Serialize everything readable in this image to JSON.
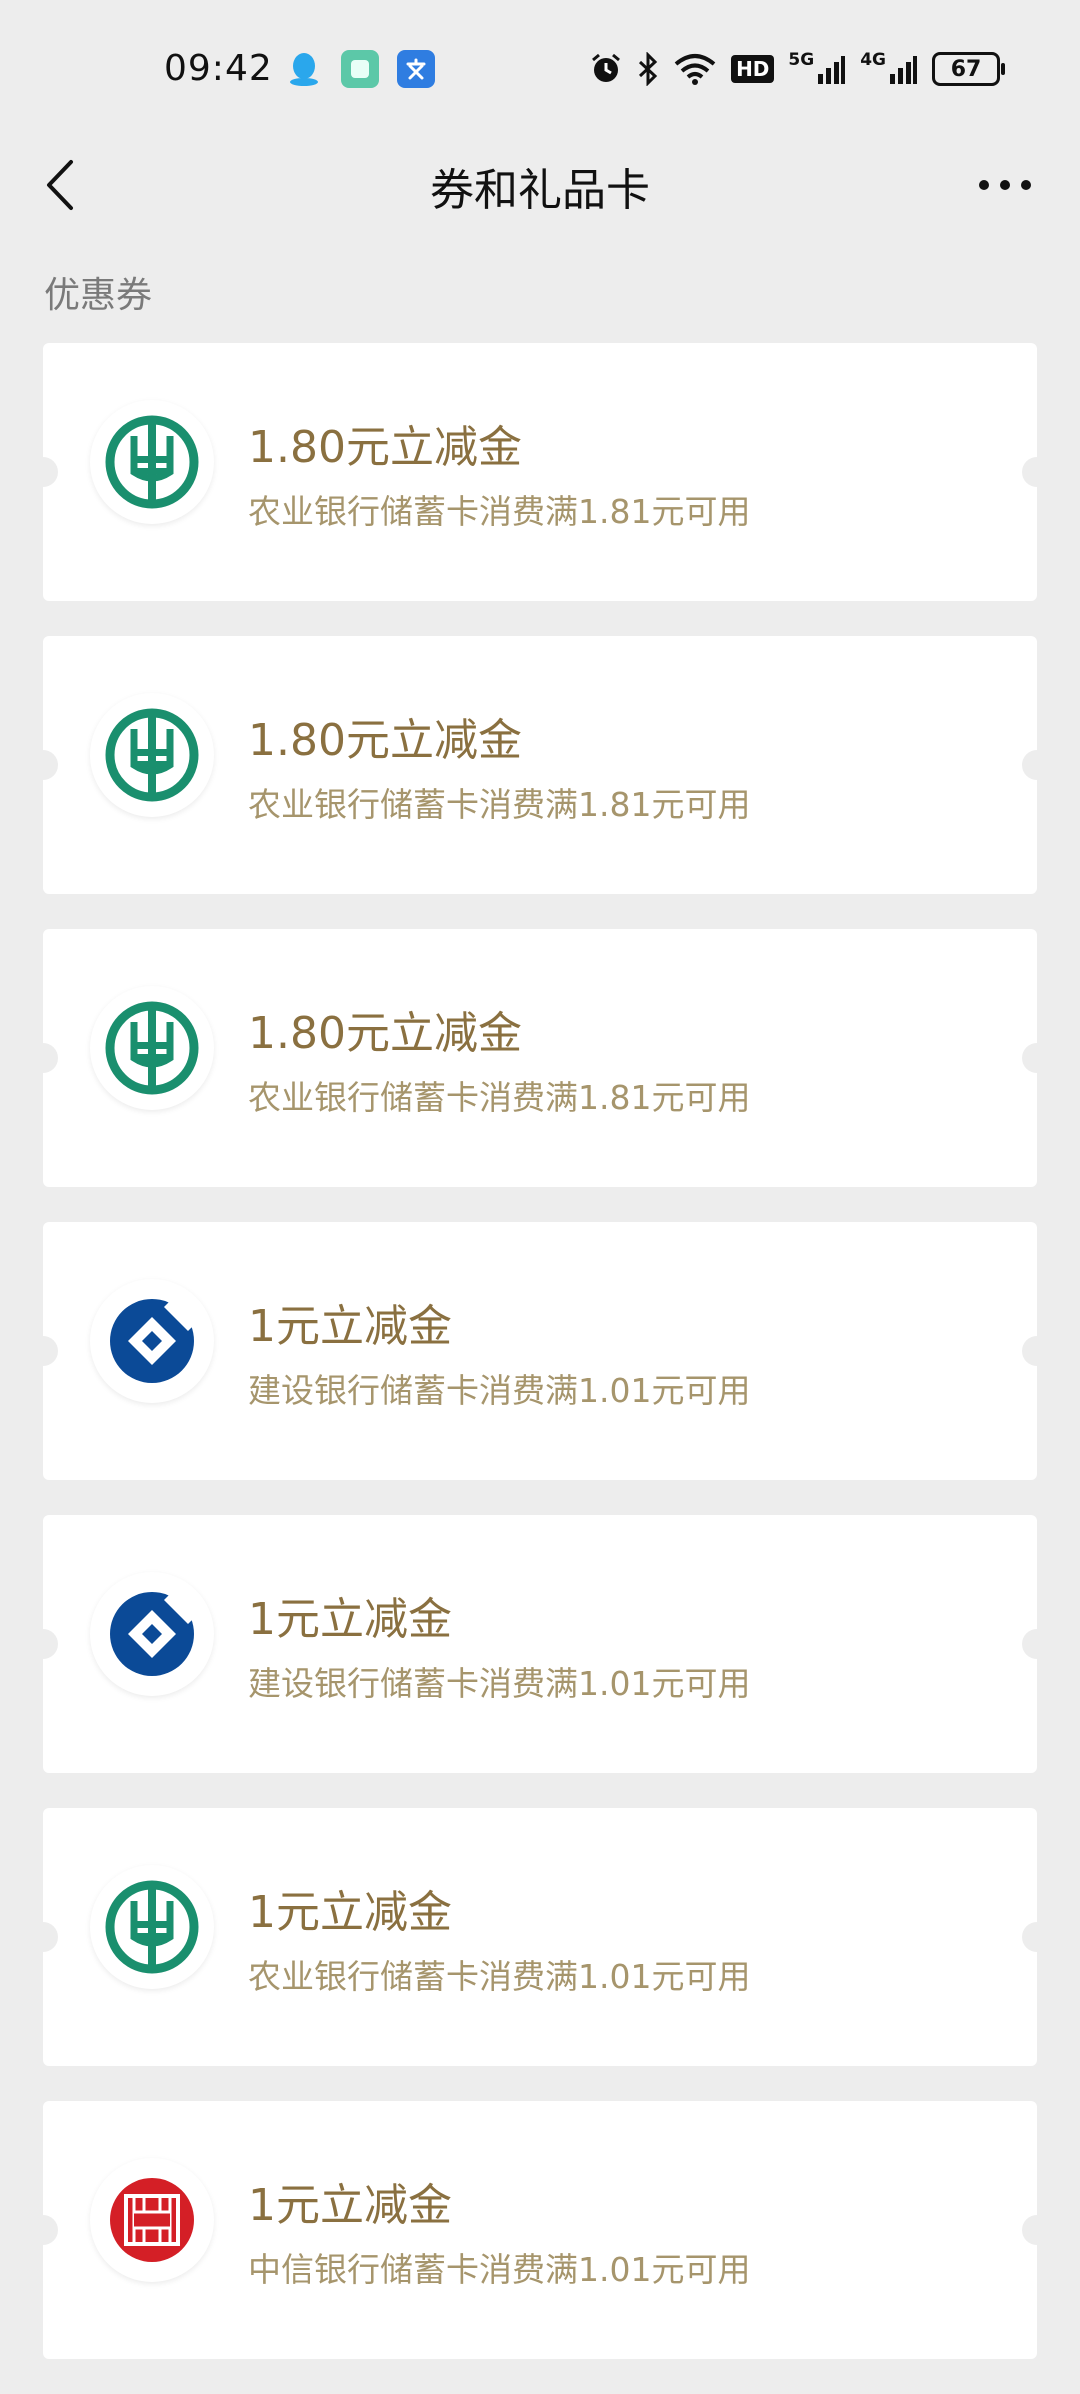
{
  "status_bar": {
    "time": "09:42",
    "app_icons": [
      "qq-icon",
      "message-app-icon",
      "translate-app-icon"
    ],
    "icons": [
      "alarm-icon",
      "bluetooth-icon",
      "wifi-icon",
      "hd-icon",
      "signal-5g-icon",
      "signal-4g-icon"
    ],
    "hd_label": "HD",
    "label_5g": "5G",
    "label_4g": "4G",
    "battery": "67"
  },
  "nav": {
    "title": "券和礼品卡"
  },
  "section": {
    "label": "优惠券"
  },
  "coupons": [
    {
      "bank": "abc",
      "title": "1.80元立减金",
      "desc": "农业银行储蓄卡消费满1.81元可用"
    },
    {
      "bank": "abc",
      "title": "1.80元立减金",
      "desc": "农业银行储蓄卡消费满1.81元可用"
    },
    {
      "bank": "abc",
      "title": "1.80元立减金",
      "desc": "农业银行储蓄卡消费满1.81元可用"
    },
    {
      "bank": "ccb",
      "title": "1元立减金",
      "desc": "建设银行储蓄卡消费满1.01元可用"
    },
    {
      "bank": "ccb",
      "title": "1元立减金",
      "desc": "建设银行储蓄卡消费满1.01元可用"
    },
    {
      "bank": "abc",
      "title": "1元立减金",
      "desc": "农业银行储蓄卡消费满1.01元可用"
    },
    {
      "bank": "citic",
      "title": "1元立减金",
      "desc": "中信银行储蓄卡消费满1.01元可用"
    }
  ],
  "colors": {
    "background": "#ededed",
    "coupon_title": "#8a7040",
    "coupon_desc": "#a6956c",
    "abc_green": "#1a8f6e",
    "ccb_blue": "#0b4a97",
    "citic_red": "#d41f26"
  }
}
